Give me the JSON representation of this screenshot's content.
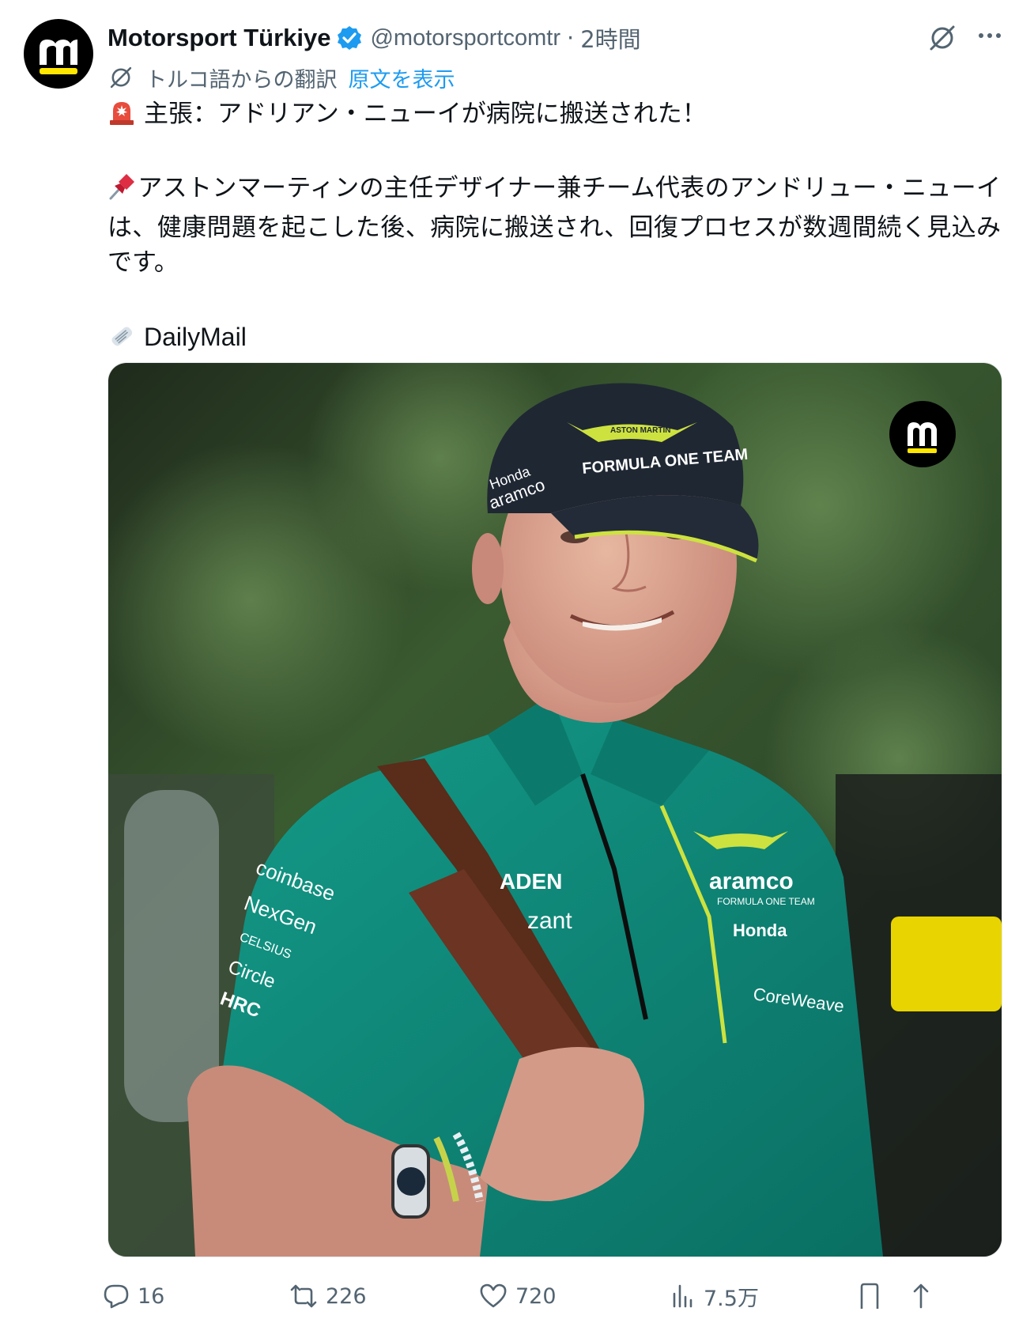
{
  "post": {
    "account_name": "Motorsport Türkiye",
    "handle": "@motorsportcomtr",
    "separator": "·",
    "time": "2時間",
    "translation_label": "トルコ語からの翻訳",
    "show_original": "原文を表示",
    "lines": [
      "主張：アドリアン・ニューイが病院に搬送された！",
      "アストンマーティンの主任デザイナー兼チーム代表のアンドリュー・ニューイは、健康問題を起こした後、病院に搬送され、回復プロセスが数週間続く見込みです。",
      "DailyMail"
    ],
    "image": {
      "cap_text": "FORMULA ONE TEAM",
      "cap_brand": "ASTON MARTIN",
      "cap_side_1": "Honda",
      "cap_side_2": "aramco",
      "shirt_right_1": "aramco",
      "shirt_right_2": "FORMULA ONE TEAM",
      "shirt_right_3": "Honda",
      "shirt_right_4": "CoreWeave",
      "shirt_sleeve_1": "coinbase",
      "shirt_sleeve_2": "NexGen",
      "shirt_sleeve_3": "CELSIUS",
      "shirt_sleeve_4": "Circle",
      "shirt_sleeve_5": "HRC",
      "shirt_center_1": "ADEN",
      "shirt_center_2": "zant"
    }
  },
  "actions": {
    "replies": "16",
    "reposts": "226",
    "likes": "720",
    "views": "7.5万"
  },
  "colors": {
    "verified": "#1d9bf0",
    "link": "#1d9bf0",
    "muted": "#536471",
    "brand_yellow": "#ffe600",
    "shirt_green": "#0e8a7a",
    "lime": "#cde23f"
  }
}
